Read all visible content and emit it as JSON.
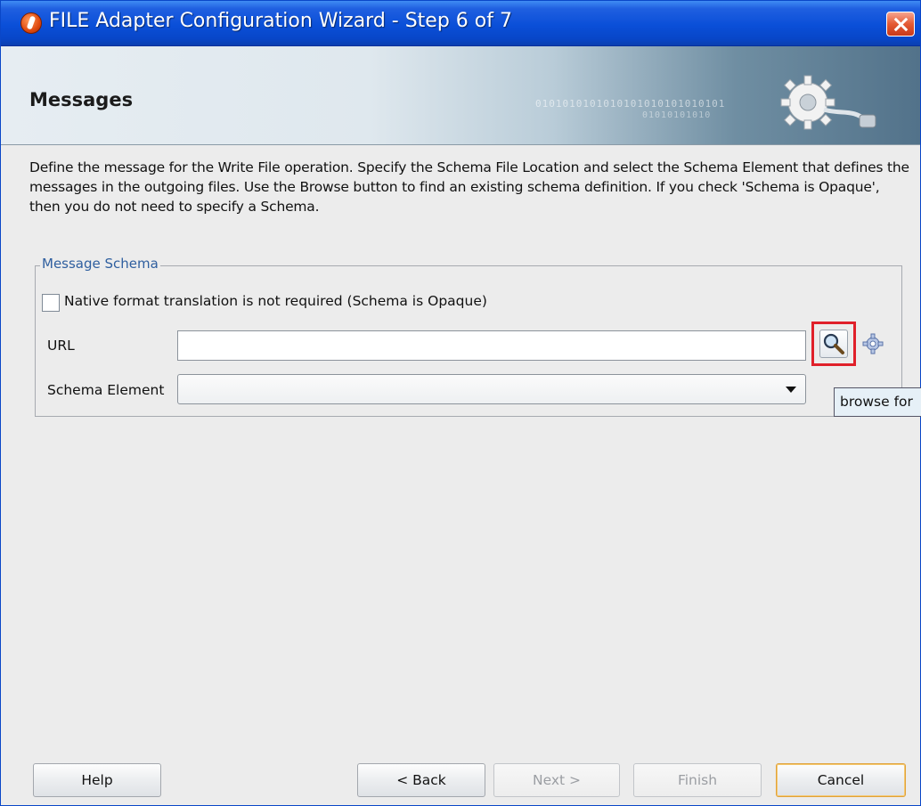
{
  "window": {
    "title": "FILE Adapter Configuration Wizard - Step 6 of 7"
  },
  "banner": {
    "title": "Messages",
    "binary_line1": "0101010101010101010101010101",
    "binary_line2": "01010101010"
  },
  "description": "Define the message for the Write File operation.  Specify the Schema File Location and select the Schema Element that defines the messages in the outgoing files. Use the Browse button to find an existing schema definition. If you check 'Schema is Opaque', then you do not need to specify a Schema.",
  "message_schema": {
    "legend": "Message Schema",
    "opaque_checkbox": {
      "label": "Native format translation is not required (Schema is Opaque)",
      "checked": false
    },
    "url": {
      "label": "URL",
      "value": ""
    },
    "schema_element": {
      "label": "Schema Element",
      "selected": ""
    },
    "tooltip": "browse for"
  },
  "buttons": {
    "help": "Help",
    "back": "< Back",
    "next": "Next >",
    "finish": "Finish",
    "cancel": "Cancel"
  },
  "colors": {
    "titlebar": "#0a4fd8",
    "highlight_border": "#e0202a",
    "legend_text": "#2f5f9f"
  }
}
